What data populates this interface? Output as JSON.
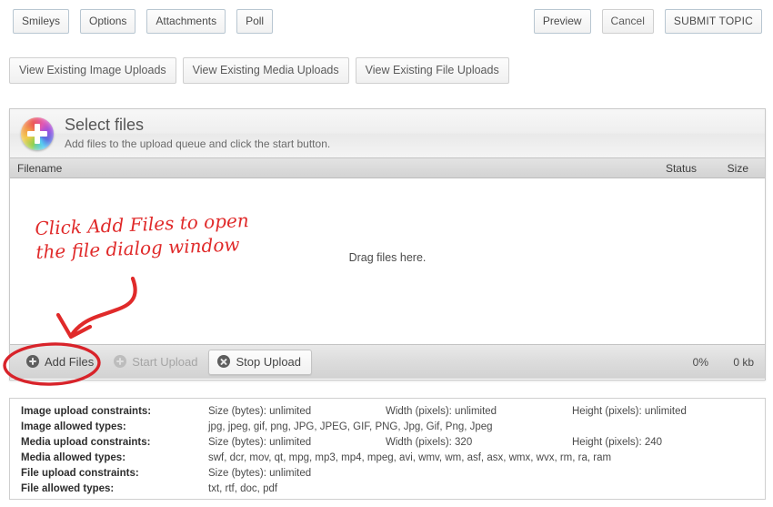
{
  "toolbar_left": [
    {
      "label": "Smileys",
      "name": "smileys-button"
    },
    {
      "label": "Options",
      "name": "options-button"
    },
    {
      "label": "Attachments",
      "name": "attachments-button"
    },
    {
      "label": "Poll",
      "name": "poll-button"
    }
  ],
  "toolbar_right": [
    {
      "label": "Preview",
      "name": "preview-button"
    },
    {
      "label": "Cancel",
      "name": "cancel-button"
    },
    {
      "label": "SUBMIT TOPIC",
      "name": "submit-topic-button"
    }
  ],
  "view_row": [
    {
      "label": "View Existing Image Uploads",
      "name": "view-existing-image-uploads-button"
    },
    {
      "label": "View Existing Media Uploads",
      "name": "view-existing-media-uploads-button"
    },
    {
      "label": "View Existing File Uploads",
      "name": "view-existing-file-uploads-button"
    }
  ],
  "uploader": {
    "icon": "color-wheel-plus-icon",
    "title": "Select files",
    "subtitle": "Add files to the upload queue and click the start button.",
    "columns": {
      "filename": "Filename",
      "status": "Status",
      "size": "Size"
    },
    "drop_hint": "Drag files here.",
    "buttons": {
      "add_files": "Add Files",
      "start_upload": "Start Upload",
      "stop_upload": "Stop Upload"
    },
    "progress_percent": "0%",
    "progress_size": "0 kb"
  },
  "constraints": [
    {
      "label": "Image upload constraints:",
      "v1": "Size (bytes):  unlimited",
      "v2": "Width (pixels):  unlimited",
      "v3": "Height (pixels):  unlimited"
    },
    {
      "label": "Image allowed types:",
      "v1": "jpg, jpeg, gif, png, JPG, JPEG, GIF, PNG, Jpg, Gif, Png, Jpeg",
      "v2": "",
      "v3": ""
    },
    {
      "label": "Media upload constraints:",
      "v1": "Size (bytes):  unlimited",
      "v2": "Width (pixels):  320",
      "v3": "Height (pixels):  240"
    },
    {
      "label": "Media allowed types:",
      "v1": "swf, dcr, mov, qt, mpg, mp3, mp4, mpeg, avi, wmv, wm, asf, asx, wmx, wvx, rm, ra, ram",
      "v2": "",
      "v3": ""
    },
    {
      "label": "File upload constraints:",
      "v1": "Size (bytes):  unlimited",
      "v2": "",
      "v3": ""
    },
    {
      "label": "File allowed types:",
      "v1": "txt, rtf, doc, pdf",
      "v2": "",
      "v3": ""
    }
  ],
  "annotation": {
    "text": "Click Add Files to open\nthe file dialog window",
    "color": "#e02a2a",
    "arrow": "curved-arrow-pointing-down-left",
    "highlight": "ellipse-around-add-files-button"
  }
}
